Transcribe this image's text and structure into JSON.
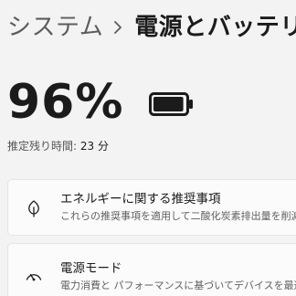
{
  "breadcrumb": {
    "parent": "システム",
    "separator_icon": "chevron-right-icon",
    "current": "電源とバッテリー"
  },
  "battery": {
    "percent_text": "96%",
    "level": 0.96,
    "icon": "battery-icon",
    "remaining_label": "推定残り時間:",
    "remaining_value": "23 分"
  },
  "cards": [
    {
      "icon": "leaf-icon",
      "title": "エネルギーに関する推奨事項",
      "description": "これらの推奨事項を適用して二酸化炭素排出量を削減"
    },
    {
      "icon": "gauge-icon",
      "title": "電源モード",
      "description": "電力消費と パフォーマンスに基づいてデバイスを最適化"
    }
  ]
}
